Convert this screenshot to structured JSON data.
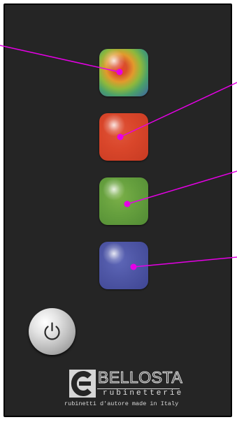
{
  "buttons": [
    {
      "name": "multicolor-light-button",
      "color": "#e8412c"
    },
    {
      "name": "red-light-button",
      "color": "#d9462a"
    },
    {
      "name": "green-light-button",
      "color": "#66a03e"
    },
    {
      "name": "blue-light-button",
      "color": "#4f57a6"
    }
  ],
  "power": {
    "icon": "power-icon"
  },
  "brand": {
    "logo_icon": "bellosta-logo-icon",
    "name": "BELLOSTA",
    "subtitle": "rubinetterie",
    "tagline": "rubinetti d'autore made in Italy"
  },
  "colors": {
    "panel": "#252525",
    "callout": "#e600e6"
  }
}
